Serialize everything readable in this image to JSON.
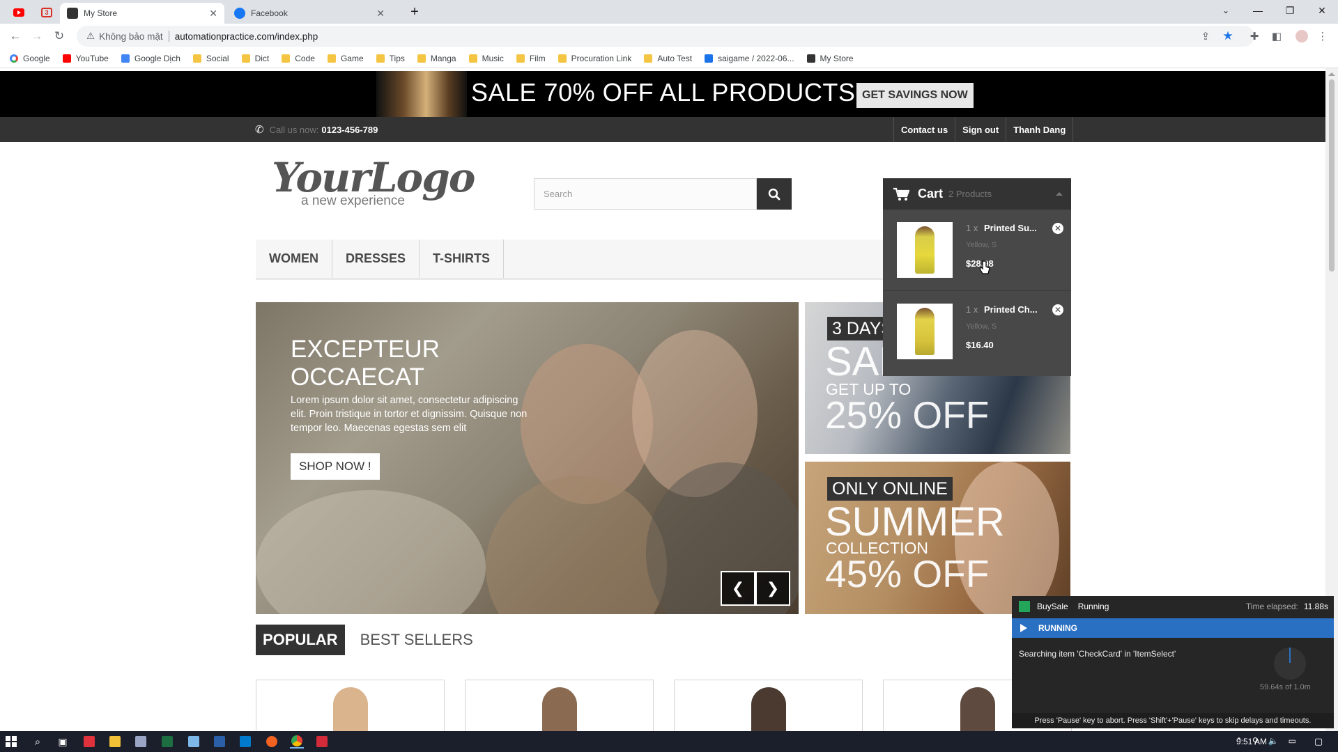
{
  "browser": {
    "tabs": [
      {
        "title": "My Store",
        "active": true
      },
      {
        "title": "Facebook",
        "active": false
      }
    ],
    "pinned_badge": "3",
    "address": {
      "security_label": "Không bảo mật",
      "url": "automationpractice.com/index.php"
    },
    "bookmarks": [
      {
        "label": "Google",
        "icon": "google-icon"
      },
      {
        "label": "YouTube",
        "icon": "youtube-icon"
      },
      {
        "label": "Google Dịch",
        "icon": "translate-icon"
      },
      {
        "label": "Social",
        "icon": "folder-icon"
      },
      {
        "label": "Dict",
        "icon": "folder-icon"
      },
      {
        "label": "Code",
        "icon": "folder-icon"
      },
      {
        "label": "Game",
        "icon": "folder-icon"
      },
      {
        "label": "Tips",
        "icon": "folder-icon"
      },
      {
        "label": "Manga",
        "icon": "folder-icon"
      },
      {
        "label": "Music",
        "icon": "folder-icon"
      },
      {
        "label": "Film",
        "icon": "folder-icon"
      },
      {
        "label": "Procuration Link",
        "icon": "folder-icon"
      },
      {
        "label": "Auto Test",
        "icon": "folder-icon"
      },
      {
        "label": "saigame / 2022-06...",
        "icon": "saigame-icon"
      },
      {
        "label": "My Store",
        "icon": "store-icon"
      }
    ]
  },
  "store": {
    "promo": {
      "headline": "SALE 70% OFF ALL PRODUCTS",
      "button": "GET SAVINGS NOW"
    },
    "nav": {
      "call_label": "Call us now:",
      "phone": "0123-456-789",
      "links": [
        "Contact us",
        "Sign out",
        "Thanh Dang"
      ]
    },
    "logo": {
      "main": "YourLogo",
      "tagline": "a new experience"
    },
    "search": {
      "placeholder": "Search"
    },
    "menu": [
      "WOMEN",
      "DRESSES",
      "T-SHIRTS"
    ],
    "slider": {
      "title_line1": "EXCEPTEUR",
      "title_line2": "OCCAECAT",
      "description": "Lorem ipsum dolor sit amet, consectetur adipiscing elit. Proin tristique in tortor et dignissim. Quisque non tempor leo. Maecenas egestas sem elit",
      "button": "SHOP NOW !"
    },
    "banners": [
      {
        "tag": "3 DAYS",
        "big": "SALE",
        "small": "GET UP TO",
        "off": "25% OFF"
      },
      {
        "tag": "ONLY ONLINE",
        "big": "SUMMER",
        "small": "COLLECTION",
        "off": "45% OFF"
      }
    ],
    "tabs": [
      {
        "label": "POPULAR",
        "active": true
      },
      {
        "label": "BEST SELLERS",
        "active": false
      }
    ],
    "cart": {
      "label": "Cart",
      "count": "2 Products",
      "items": [
        {
          "qty": "1 x",
          "name": "Printed Su...",
          "attributes": "Yellow, S",
          "price": "$28.98"
        },
        {
          "qty": "1 x",
          "name": "Printed Ch...",
          "attributes": "Yellow, S",
          "price": "$16.40"
        }
      ]
    }
  },
  "runner": {
    "name": "BuySale",
    "state": "Running",
    "elapsed_label": "Time elapsed:",
    "elapsed": "11.88s",
    "status": "RUNNING",
    "message": "Searching item 'CheckCard' in 'ItemSelect'",
    "timeout": "59.64s of 1.0m",
    "footer": "Press 'Pause' key to abort. Press 'Shift'+'Pause' keys to skip delays and timeouts."
  },
  "taskbar": {
    "time": "9:51 AM"
  },
  "colors": {
    "accent": "#333333",
    "runner_blue": "#2a70c2",
    "cart_bg": "#484848"
  }
}
